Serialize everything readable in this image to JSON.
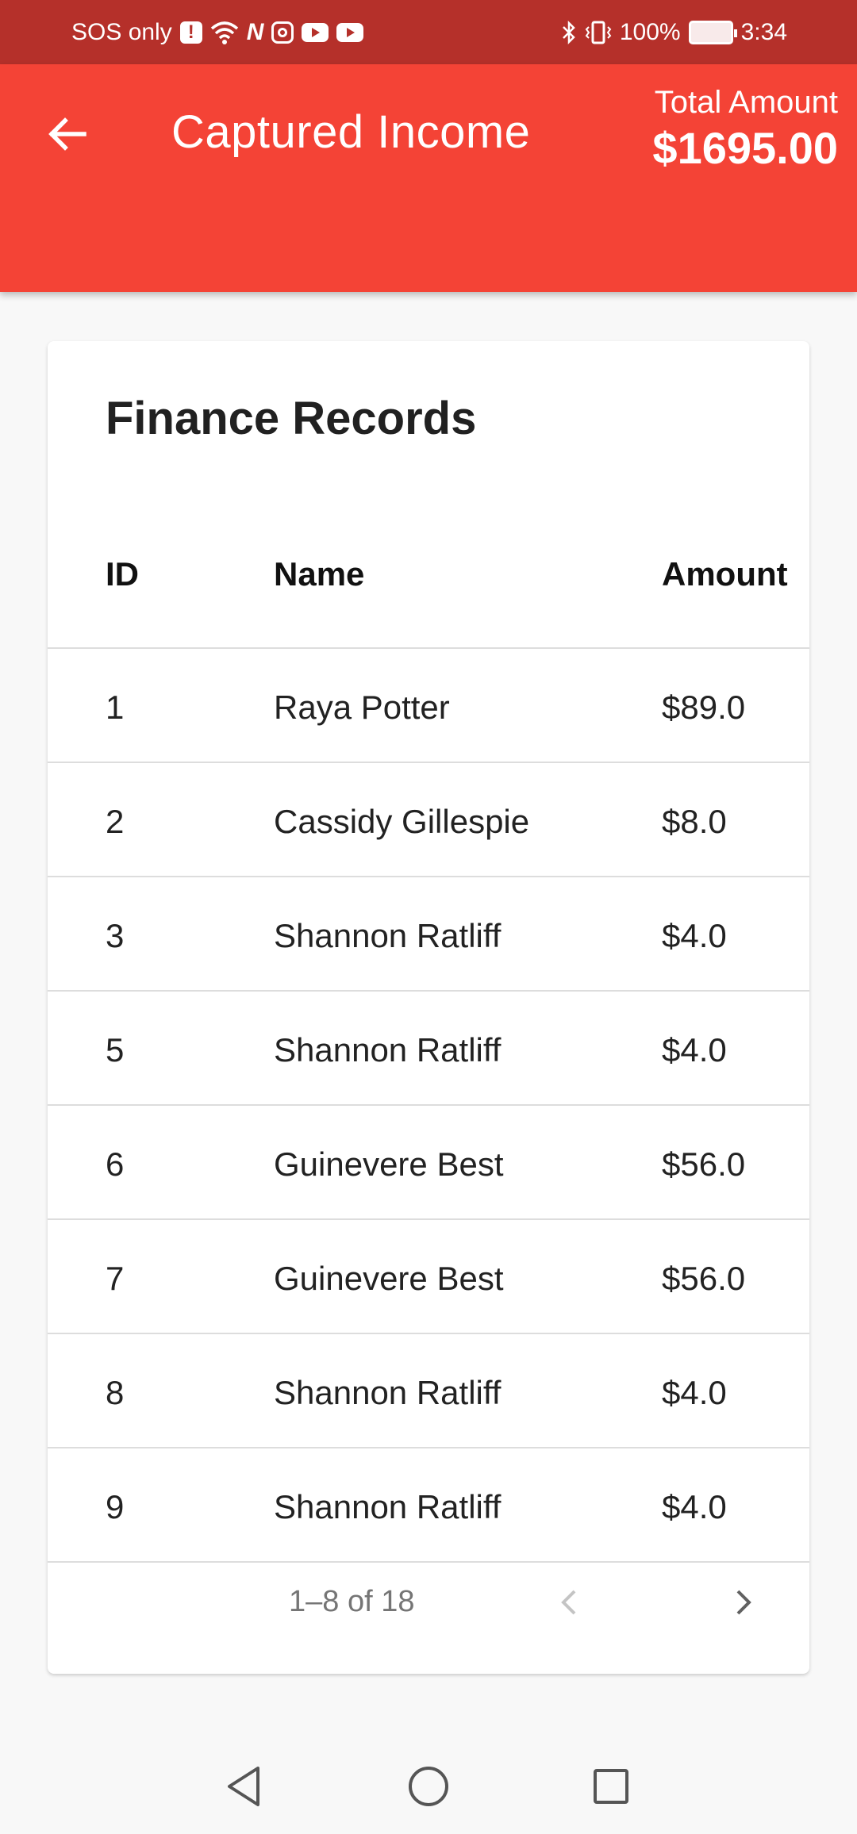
{
  "status_bar": {
    "carrier_text": "SOS only",
    "battery_percent": "100%",
    "time": "3:34",
    "icons": [
      "alert-icon",
      "wifi-icon",
      "n-app-icon",
      "instagram-icon",
      "youtube-icon",
      "youtube-icon",
      "bluetooth-icon",
      "vibrate-icon",
      "battery-charging-icon"
    ]
  },
  "app_bar": {
    "title": "Captured Income",
    "total_label": "Total Amount",
    "total_value": "$1695.00",
    "background_color": "#f44336"
  },
  "card": {
    "title": "Finance Records",
    "columns": [
      "ID",
      "Name",
      "Amount"
    ],
    "rows": [
      {
        "id": "1",
        "name": "Raya Potter",
        "amount": "$89.0"
      },
      {
        "id": "2",
        "name": "Cassidy Gillespie",
        "amount": "$8.0"
      },
      {
        "id": "3",
        "name": "Shannon Ratliff",
        "amount": "$4.0"
      },
      {
        "id": "5",
        "name": "Shannon Ratliff",
        "amount": "$4.0"
      },
      {
        "id": "6",
        "name": "Guinevere Best",
        "amount": "$56.0"
      },
      {
        "id": "7",
        "name": "Guinevere Best",
        "amount": "$56.0"
      },
      {
        "id": "8",
        "name": "Shannon Ratliff",
        "amount": "$4.0"
      },
      {
        "id": "9",
        "name": "Shannon Ratliff",
        "amount": "$4.0"
      }
    ],
    "pagination": {
      "text": "1–8 of 18",
      "prev_enabled": false,
      "next_enabled": true
    }
  }
}
